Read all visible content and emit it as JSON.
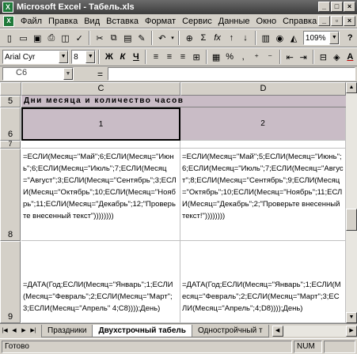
{
  "window": {
    "title": "Microsoft Excel - Табель.xls",
    "app_icon": "excel-icon"
  },
  "menu": [
    "Файл",
    "Правка",
    "Вид",
    "Вставка",
    "Формат",
    "Сервис",
    "Данные",
    "Окно",
    "Справка"
  ],
  "toolbar": {
    "zoom": "109%",
    "font_name": "Arial Cyr",
    "font_size": "8",
    "bold": "Ж",
    "italic": "К",
    "underline": "Ч",
    "sum": "Σ",
    "fx": "fx",
    "undo": "↶",
    "help": "?"
  },
  "formula_bar": {
    "name_box": "C6",
    "equals": "="
  },
  "columns": [
    "C",
    "D"
  ],
  "rows": {
    "r5": "5",
    "r6": "6",
    "r7": "7",
    "r8": "8",
    "r9": "9"
  },
  "cells": {
    "title": "Дни месяца и количество часов",
    "c6": "1",
    "d6": "2",
    "c8": "=ЕСЛИ(Месяц=\"Май\";6;ЕСЛИ(Месяц=\"Июнь\";6;ЕСЛИ(Месяц=\"Июль\";7;ЕСЛИ(Месяц=\"Август\";3;ЕСЛИ(Месяц=\"Сентябрь\";3;ЕСЛИ(Месяц=\"Октябрь\";10;ЕСЛИ(Месяц=\"Ноябрь\";11;ЕСЛИ(Месяц=\"Декабрь\";12;\"Проверьте внесенный текст\"))))))))",
    "d8": "=ЕСЛИ(Месяц=\"Май\";5;ЕСЛИ(Месяц=\"Июнь\";6;ЕСЛИ(Месяц=\"Июль\";7;ЕСЛИ(Месяц=\"Август\";8;ЕСЛИ(Месяц=\"Сентябрь\";9;ЕСЛИ(Месяц=\"Октябрь\";10;ЕСЛИ(Месяц=\"Ноябрь\";11;ЕСЛИ(Месяц=\"Декабрь\";2;\"Проверьте внесенный текст!\"))))))))",
    "c9": "=ДАТА(Год;ЕСЛИ(Месяц=\"Январь\";1;ЕСЛИ(Месяц=\"Февраль\";2;ЕСЛИ(Месяц=\"Март\";3;ЕСЛИ(Месяц=\"Апрель\" 4;C8))));День)",
    "d9": "=ДАТА(Год;ЕСЛИ(Месяц=\"Январь\";1;ЕСЛИ(Месяц=\"Февраль\";2;ЕСЛИ(Месяц=\"Март\";3;ЕСЛИ(Месяц=\"Апрель\";4;D8))));День)"
  },
  "sheet_tabs": [
    "Праздники",
    "Двухстрочный табель",
    "Одностройчный т"
  ],
  "status": {
    "text": "Готово",
    "num": "NUM"
  }
}
